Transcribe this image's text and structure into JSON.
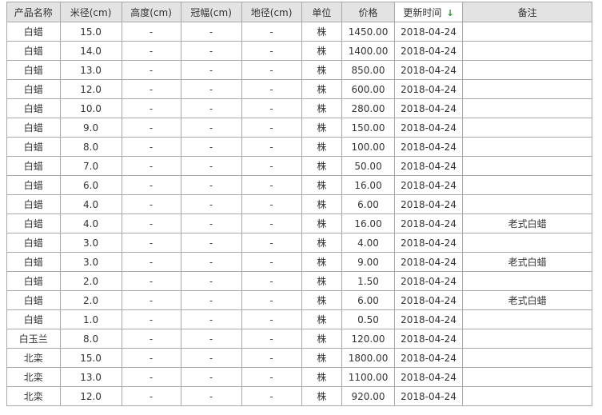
{
  "table": {
    "headers": [
      {
        "key": "name",
        "label": "产品名称"
      },
      {
        "key": "mijing",
        "label": "米径(cm)"
      },
      {
        "key": "height",
        "label": "高度(cm)"
      },
      {
        "key": "crown",
        "label": "冠幅(cm)"
      },
      {
        "key": "dijing",
        "label": "地径(cm)"
      },
      {
        "key": "unit",
        "label": "单位"
      },
      {
        "key": "price",
        "label": "价格"
      },
      {
        "key": "date",
        "label": "更新时间",
        "sort_arrow": "↓",
        "sorted": true
      },
      {
        "key": "note",
        "label": "备注"
      }
    ],
    "rows": [
      {
        "name": "白蜡",
        "mijing": "15.0",
        "height": "-",
        "crown": "-",
        "dijing": "-",
        "unit": "株",
        "price": "1450.00",
        "date": "2018-04-24",
        "note": ""
      },
      {
        "name": "白蜡",
        "mijing": "14.0",
        "height": "-",
        "crown": "-",
        "dijing": "-",
        "unit": "株",
        "price": "1400.00",
        "date": "2018-04-24",
        "note": ""
      },
      {
        "name": "白蜡",
        "mijing": "13.0",
        "height": "-",
        "crown": "-",
        "dijing": "-",
        "unit": "株",
        "price": "850.00",
        "date": "2018-04-24",
        "note": ""
      },
      {
        "name": "白蜡",
        "mijing": "12.0",
        "height": "-",
        "crown": "-",
        "dijing": "-",
        "unit": "株",
        "price": "600.00",
        "date": "2018-04-24",
        "note": ""
      },
      {
        "name": "白蜡",
        "mijing": "10.0",
        "height": "-",
        "crown": "-",
        "dijing": "-",
        "unit": "株",
        "price": "280.00",
        "date": "2018-04-24",
        "note": ""
      },
      {
        "name": "白蜡",
        "mijing": "9.0",
        "height": "-",
        "crown": "-",
        "dijing": "-",
        "unit": "株",
        "price": "150.00",
        "date": "2018-04-24",
        "note": ""
      },
      {
        "name": "白蜡",
        "mijing": "8.0",
        "height": "-",
        "crown": "-",
        "dijing": "-",
        "unit": "株",
        "price": "100.00",
        "date": "2018-04-24",
        "note": ""
      },
      {
        "name": "白蜡",
        "mijing": "7.0",
        "height": "-",
        "crown": "-",
        "dijing": "-",
        "unit": "株",
        "price": "50.00",
        "date": "2018-04-24",
        "note": ""
      },
      {
        "name": "白蜡",
        "mijing": "6.0",
        "height": "-",
        "crown": "-",
        "dijing": "-",
        "unit": "株",
        "price": "16.00",
        "date": "2018-04-24",
        "note": ""
      },
      {
        "name": "白蜡",
        "mijing": "4.0",
        "height": "-",
        "crown": "-",
        "dijing": "-",
        "unit": "株",
        "price": "6.00",
        "date": "2018-04-24",
        "note": ""
      },
      {
        "name": "白蜡",
        "mijing": "4.0",
        "height": "-",
        "crown": "-",
        "dijing": "-",
        "unit": "株",
        "price": "16.00",
        "date": "2018-04-24",
        "note": "老式白蜡"
      },
      {
        "name": "白蜡",
        "mijing": "3.0",
        "height": "-",
        "crown": "-",
        "dijing": "-",
        "unit": "株",
        "price": "4.00",
        "date": "2018-04-24",
        "note": ""
      },
      {
        "name": "白蜡",
        "mijing": "3.0",
        "height": "-",
        "crown": "-",
        "dijing": "-",
        "unit": "株",
        "price": "9.00",
        "date": "2018-04-24",
        "note": "老式白蜡"
      },
      {
        "name": "白蜡",
        "mijing": "2.0",
        "height": "-",
        "crown": "-",
        "dijing": "-",
        "unit": "株",
        "price": "1.50",
        "date": "2018-04-24",
        "note": ""
      },
      {
        "name": "白蜡",
        "mijing": "2.0",
        "height": "-",
        "crown": "-",
        "dijing": "-",
        "unit": "株",
        "price": "6.00",
        "date": "2018-04-24",
        "note": "老式白蜡"
      },
      {
        "name": "白蜡",
        "mijing": "1.0",
        "height": "-",
        "crown": "-",
        "dijing": "-",
        "unit": "株",
        "price": "0.50",
        "date": "2018-04-24",
        "note": ""
      },
      {
        "name": "白玉兰",
        "mijing": "8.0",
        "height": "-",
        "crown": "-",
        "dijing": "-",
        "unit": "株",
        "price": "120.00",
        "date": "2018-04-24",
        "note": ""
      },
      {
        "name": "北栾",
        "mijing": "15.0",
        "height": "-",
        "crown": "-",
        "dijing": "-",
        "unit": "株",
        "price": "1800.00",
        "date": "2018-04-24",
        "note": ""
      },
      {
        "name": "北栾",
        "mijing": "13.0",
        "height": "-",
        "crown": "-",
        "dijing": "-",
        "unit": "株",
        "price": "1100.00",
        "date": "2018-04-24",
        "note": ""
      },
      {
        "name": "北栾",
        "mijing": "12.0",
        "height": "-",
        "crown": "-",
        "dijing": "-",
        "unit": "株",
        "price": "920.00",
        "date": "2018-04-24",
        "note": ""
      }
    ]
  },
  "colors": {
    "sort_arrow": "#1f9a1f",
    "header_bg": "#e3e3e3",
    "border": "#a8a8a8"
  }
}
